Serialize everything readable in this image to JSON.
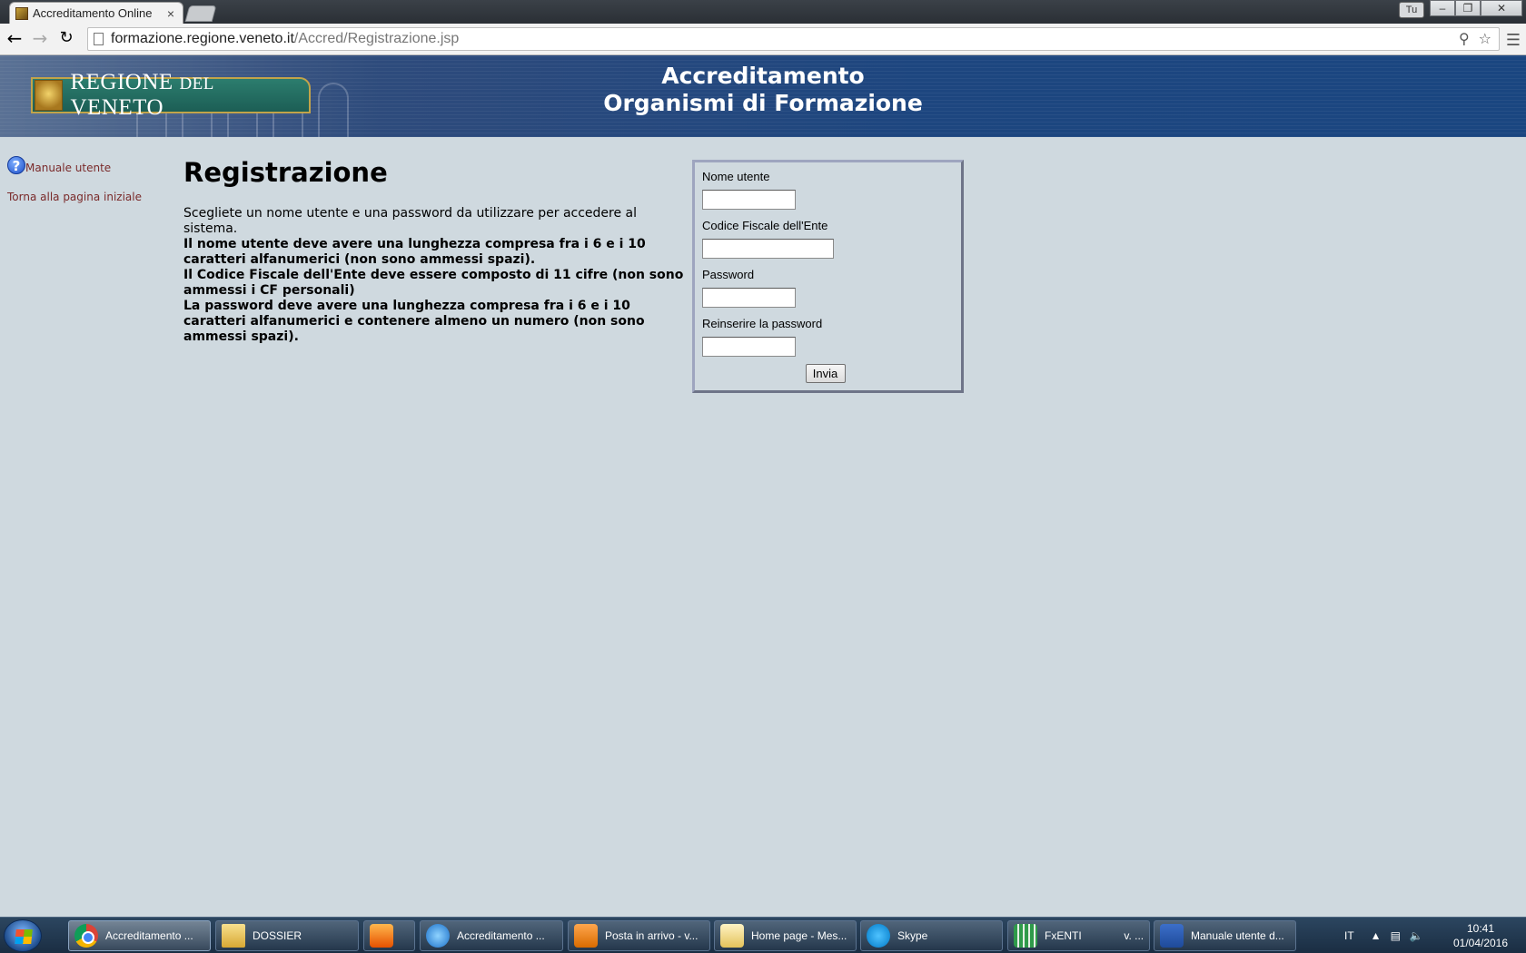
{
  "browser": {
    "tab_title": "Accreditamento Online",
    "tab_close": "×",
    "user_badge": "Tu",
    "url_host": "formazione.regione.veneto.it",
    "url_path": "/Accred/Registrazione.jsp",
    "icons": {
      "back": "arrow-left",
      "forward": "arrow-right",
      "reload": "reload",
      "key": "key",
      "star": "star",
      "menu": "hamburger"
    }
  },
  "header": {
    "logo_word1": "REGIONE ",
    "logo_word2": "DEL",
    "logo_word3": " VENETO",
    "title_line1": "Accreditamento",
    "title_line2": "Organismi di Formazione"
  },
  "nav": {
    "manual": "Manuale utente",
    "home": "Torna alla pagina iniziale"
  },
  "content": {
    "heading": "Registrazione",
    "intro": "Scegliete un nome utente e una password da utilizzare per accedere al sistema.",
    "rule1": "Il nome utente deve avere una lunghezza compresa fra i 6 e i 10 caratteri alfanumerici (non sono ammessi spazi).",
    "rule2": "Il Codice Fiscale dell'Ente deve essere composto di 11 cifre (non sono ammessi i CF personali)",
    "rule3": "La password deve avere una lunghezza compresa fra i 6 e i 10 caratteri alfanumerici e contenere almeno un numero (non sono ammessi spazi)."
  },
  "form": {
    "username_label": "Nome utente",
    "username_value": "",
    "cf_label": "Codice Fiscale dell'Ente",
    "cf_value": "",
    "password_label": "Password",
    "password_value": "",
    "password2_label": "Reinserire la password",
    "password2_value": "",
    "submit_label": "Invia"
  },
  "taskbar": {
    "items": [
      {
        "label": "Accreditamento ...",
        "icon": "chrome-icon"
      },
      {
        "label": "DOSSIER",
        "icon": "folder-icon"
      },
      {
        "label": "",
        "icon": "media-player-icon"
      },
      {
        "label": "Accreditamento ...",
        "icon": "internet-explorer-icon"
      },
      {
        "label": "Posta in arrivo - v...",
        "icon": "outlook-icon"
      },
      {
        "label": "Home page - Mes...",
        "icon": "mail-icon"
      },
      {
        "label": "Skype",
        "icon": "skype-icon"
      },
      {
        "label": "FxENTI              v. ...",
        "icon": "fxenti-icon"
      },
      {
        "label": "Manuale utente d...",
        "icon": "word-icon"
      }
    ],
    "language": "IT",
    "time": "10:41",
    "date": "01/04/2016"
  }
}
